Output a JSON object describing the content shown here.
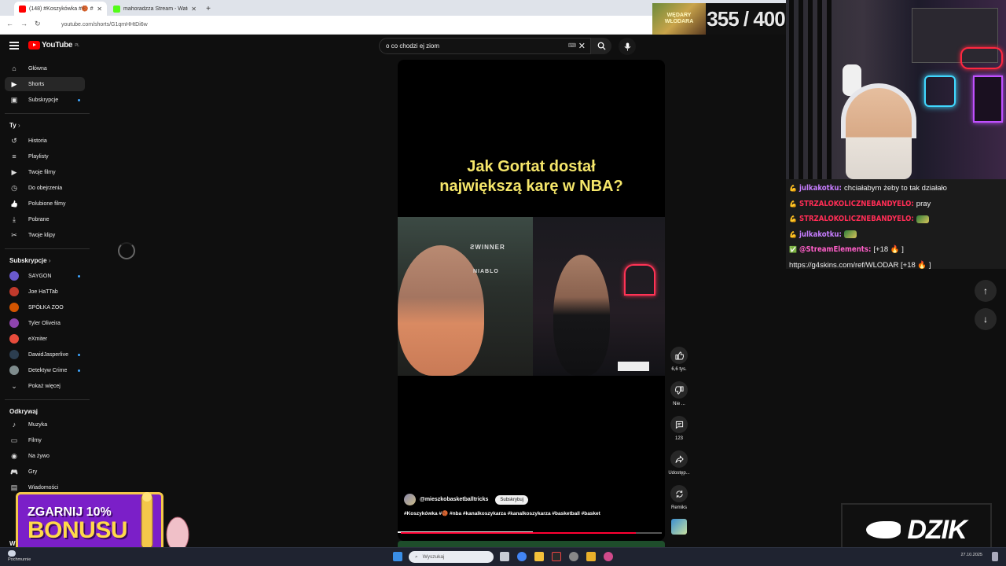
{
  "browser": {
    "tabs": [
      {
        "label": "(148) #Koszykówka #🏀 #nba",
        "active": true,
        "favicon_color": "#ff0000"
      },
      {
        "label": "mahoradzza Stream - Watch Li...",
        "active": false,
        "favicon_color": "#53fc18"
      }
    ],
    "new_tab": "+",
    "url": "youtube.com/shorts/G1qmHHtDi6w"
  },
  "counter": {
    "thumb_text": "WĘDARY WŁODARA",
    "value": "355 / 400"
  },
  "youtube": {
    "logo_text": "YouTube",
    "region": "PL",
    "search": {
      "value": "o co chodzi ej ziom",
      "kbd": "⌨"
    },
    "sidebar": {
      "main": [
        {
          "label": "Główna",
          "icon": "home-icon",
          "glyph": "⌂"
        },
        {
          "label": "Shorts",
          "icon": "shorts-icon",
          "glyph": "▶",
          "active": true
        },
        {
          "label": "Subskrypcje",
          "icon": "subscriptions-icon",
          "glyph": "▣",
          "dot": true
        }
      ],
      "you_title": "Ty",
      "you": [
        {
          "label": "Historia",
          "icon": "history-icon",
          "glyph": "↺"
        },
        {
          "label": "Playlisty",
          "icon": "playlists-icon",
          "glyph": "≡"
        },
        {
          "label": "Twoje filmy",
          "icon": "your-videos-icon",
          "glyph": "▶"
        },
        {
          "label": "Do obejrzenia",
          "icon": "watch-later-icon",
          "glyph": "◷"
        },
        {
          "label": "Polubione filmy",
          "icon": "liked-icon",
          "glyph": "👍"
        },
        {
          "label": "Pobrane",
          "icon": "download-icon",
          "glyph": "⤓"
        },
        {
          "label": "Twoje klipy",
          "icon": "clips-icon",
          "glyph": "✂"
        }
      ],
      "subs_title": "Subskrypcje",
      "subs": [
        {
          "label": "SAYGON",
          "color": "#6a5acd",
          "dot": true
        },
        {
          "label": "Joe HaTTab",
          "color": "#c0392b"
        },
        {
          "label": "SPÓŁKA ZOO",
          "color": "#d35400"
        },
        {
          "label": "Tyler Oliveira",
          "color": "#8e44ad"
        },
        {
          "label": "eXmiter",
          "color": "#e74c3c"
        },
        {
          "label": "DawidJasperlive",
          "color": "#2c3e50",
          "dot": true
        },
        {
          "label": "Detektyw Crime",
          "color": "#7f8c8d",
          "dot": true
        }
      ],
      "show_more": "Pokaż więcej",
      "explore_title": "Odkrywaj",
      "explore": [
        {
          "label": "Muzyka",
          "icon": "music-icon",
          "glyph": "♪"
        },
        {
          "label": "Filmy",
          "icon": "movies-icon",
          "glyph": "▭"
        },
        {
          "label": "Na żywo",
          "icon": "live-icon",
          "glyph": "◉"
        },
        {
          "label": "Gry",
          "icon": "gaming-icon",
          "glyph": "🎮"
        },
        {
          "label": "Wiadomości",
          "icon": "news-icon",
          "glyph": "▤"
        }
      ],
      "bottom_partial": "Wi"
    },
    "short": {
      "headline_line1": "Jak Gortat dostał",
      "headline_line2": "największą karę w NBA?",
      "chair_brand": "NIABLO",
      "chair_logo": "ƧWINNER",
      "channel": "@mieszkobasketballtricks",
      "subscribe": "Subskrybuj",
      "caption": "#Koszykówka #🏀 #nba #kanalkoszykarza #kanalkoszykarza #basketball #basket",
      "progress": 0.9
    },
    "actions": [
      {
        "name": "like",
        "icon": "like-icon",
        "glyph": "👍",
        "label": "6,6 tys."
      },
      {
        "name": "dislike",
        "icon": "dislike-icon",
        "glyph": "👎",
        "label": "Nie ..."
      },
      {
        "name": "comments",
        "icon": "comment-icon",
        "glyph": "▤",
        "label": "123"
      },
      {
        "name": "share",
        "icon": "share-icon",
        "glyph": "↪",
        "label": "Udostęp..."
      },
      {
        "name": "remix",
        "icon": "remix-icon",
        "glyph": "⟲",
        "label": "Remiks"
      }
    ],
    "nav": {
      "up": "↑",
      "down": "↓"
    }
  },
  "chat": [
    {
      "user": "julkakotku",
      "color": "#c77dff",
      "msg": "chciałabym żeby to tak działało",
      "badge": "💪"
    },
    {
      "user": "STRZALOKOLICZNEBANDYELO",
      "color": "#ff2d55",
      "msg": "pray",
      "badge": "💪"
    },
    {
      "user": "STRZALOKOLICZNEBANDYELO",
      "color": "#ff2d55",
      "msg": "",
      "badge": "💪",
      "emote": true
    },
    {
      "user": "julkakotku",
      "color": "#c77dff",
      "msg": "",
      "badge": "💪",
      "emote": true
    },
    {
      "user": "@StreamElements",
      "color": "#ff5ec8",
      "msg": "[+18 🔥 ]",
      "badge": "✅"
    },
    {
      "user": "",
      "color": "#ffffff",
      "msg": "https://g4skins.com/ref/WLODAR [+18 🔥 ]",
      "badge": ""
    }
  ],
  "promo": {
    "bonus_line1": "ZGARNIJ 10%",
    "bonus_line2": "BONUSU",
    "dzik": "DZIK"
  },
  "taskbar": {
    "weather": "Pochmurnie",
    "search_placeholder": "Wyszukaj",
    "time": "27.10.2025"
  }
}
